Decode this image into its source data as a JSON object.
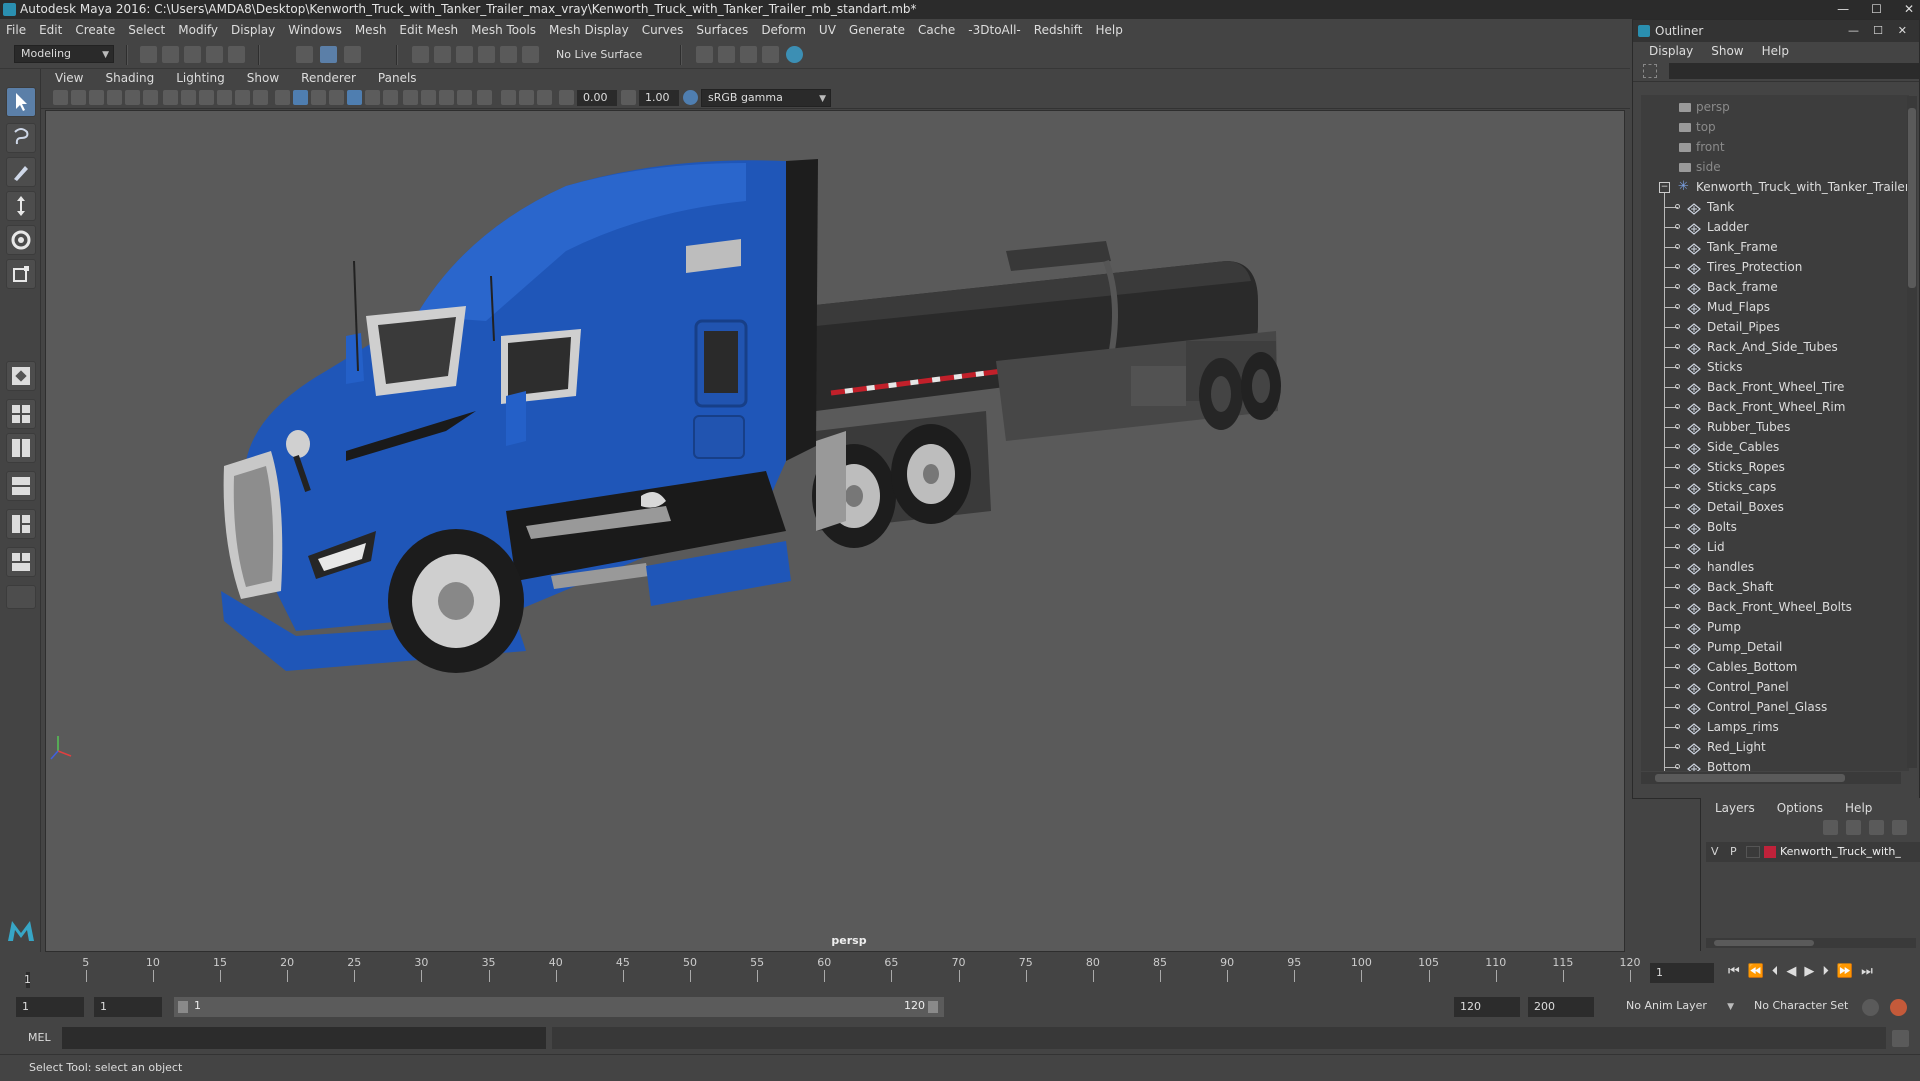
{
  "window": {
    "title": "Autodesk Maya 2016: C:\\Users\\AMDA8\\Desktop\\Kenworth_Truck_with_Tanker_Trailer_max_vray\\Kenworth_Truck_with_Tanker_Trailer_mb_standart.mb*",
    "controls": [
      "—",
      "☐",
      "✕"
    ]
  },
  "menubar": [
    "File",
    "Edit",
    "Create",
    "Select",
    "Modify",
    "Display",
    "Windows",
    "Mesh",
    "Edit Mesh",
    "Mesh Tools",
    "Mesh Display",
    "Curves",
    "Surfaces",
    "Deform",
    "UV",
    "Generate",
    "Cache",
    "-3DtoAll-",
    "Redshift",
    "Help"
  ],
  "statusline": {
    "mode": "Modeling",
    "live_surface": "No Live Surface"
  },
  "panel": {
    "menu": [
      "View",
      "Shading",
      "Lighting",
      "Show",
      "Renderer",
      "Panels"
    ],
    "exposure": "0.00",
    "gamma": "1.00",
    "color_space": "sRGB gamma",
    "camera_label": "persp"
  },
  "outliner": {
    "title": "Outliner",
    "menu": [
      "Display",
      "Show",
      "Help"
    ],
    "cameras": [
      "persp",
      "top",
      "front",
      "side"
    ],
    "group": "Kenworth_Truck_with_Tanker_Trailer_ncl",
    "children": [
      "Tank",
      "Ladder",
      "Tank_Frame",
      "Tires_Protection",
      "Back_frame",
      "Mud_Flaps",
      "Detail_Pipes",
      "Rack_And_Side_Tubes",
      "Sticks",
      "Back_Front_Wheel_Tire",
      "Back_Front_Wheel_Rim",
      "Rubber_Tubes",
      "Side_Cables",
      "Sticks_Ropes",
      "Sticks_caps",
      "Detail_Boxes",
      "Bolts",
      "Lid",
      "handles",
      "Back_Shaft",
      "Back_Front_Wheel_Bolts",
      "Pump",
      "Pump_Detail",
      "Cables_Bottom",
      "Control_Panel",
      "Control_Panel_Glass",
      "Lamps_rims",
      "Red_Light",
      "Bottom"
    ]
  },
  "layers": {
    "menu": [
      "Layers",
      "Options",
      "Help"
    ],
    "row": {
      "v": "V",
      "p": "P",
      "name": "Kenworth_Truck_with_",
      "color": "#c0223a"
    }
  },
  "timeline": {
    "labels": [
      "5",
      "10",
      "15",
      "20",
      "25",
      "30",
      "35",
      "40",
      "45",
      "50",
      "55",
      "60",
      "65",
      "70",
      "75",
      "80",
      "85",
      "90",
      "95",
      "100",
      "105",
      "110",
      "115",
      "120"
    ],
    "start_marker": "1",
    "current_frame": "1"
  },
  "range": {
    "start": "1",
    "playback_start": "1",
    "slider_start": "1",
    "slider_end": "120",
    "playback_end": "120",
    "end": "200",
    "anim_layer": "No Anim Layer",
    "character_set": "No Character Set"
  },
  "cmdline": {
    "label": "MEL"
  },
  "helpline": {
    "text": "Select Tool: select an object"
  },
  "colors": {
    "truck_blue": "#1f56b8",
    "tank": "#2b2b2b",
    "stripe_red": "#c2202a",
    "selected_tool": "#5b7fa8"
  }
}
